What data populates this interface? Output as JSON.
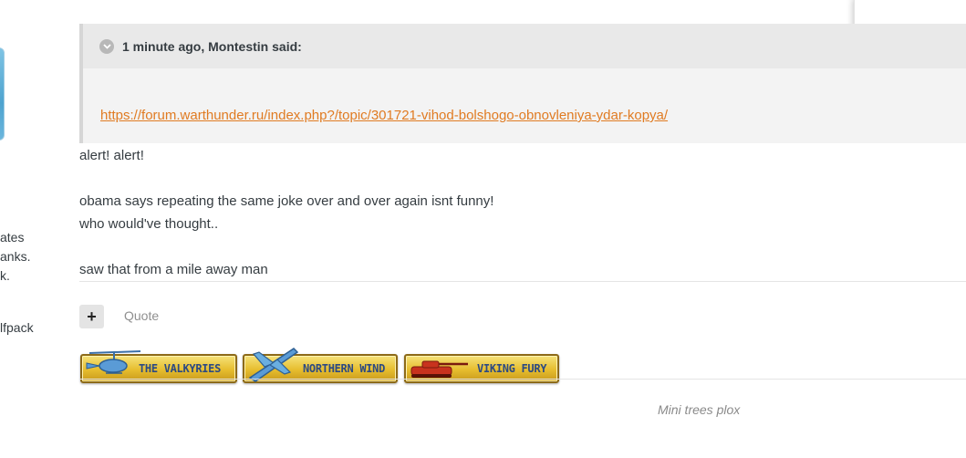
{
  "author_panel": {
    "lines": [
      "ates",
      "anks.",
      "k."
    ],
    "clan": "lfpack"
  },
  "quote": {
    "header": "1 minute ago, Montestin said:",
    "toggle_icon": "chevron-down-icon",
    "link": "https://forum.warthunder.ru/index.php?/topic/301721-vihod-bolshogo-obnovleniya-ydar-kopya/"
  },
  "post": {
    "lines": [
      "alert! alert!",
      "",
      "obama says repeating the same joke over and over again isnt funny!",
      "who would've thought..",
      "",
      "saw that from a mile away man"
    ]
  },
  "controls": {
    "plus_label": "+",
    "quote_label": "Quote"
  },
  "badges": [
    {
      "label": "THE VALKYRIES",
      "icon": "helicopter-icon"
    },
    {
      "label": "NORTHERN WIND",
      "icon": "jet-icon"
    },
    {
      "label": "VIKING FURY",
      "icon": "tank-icon"
    }
  ],
  "signature": "Mini trees plox",
  "colors": {
    "link": "#e07b22",
    "badge_gold": "#e6bd2e",
    "badge_text": "#2c4a83",
    "quote_bg": "#f3f3f3"
  }
}
